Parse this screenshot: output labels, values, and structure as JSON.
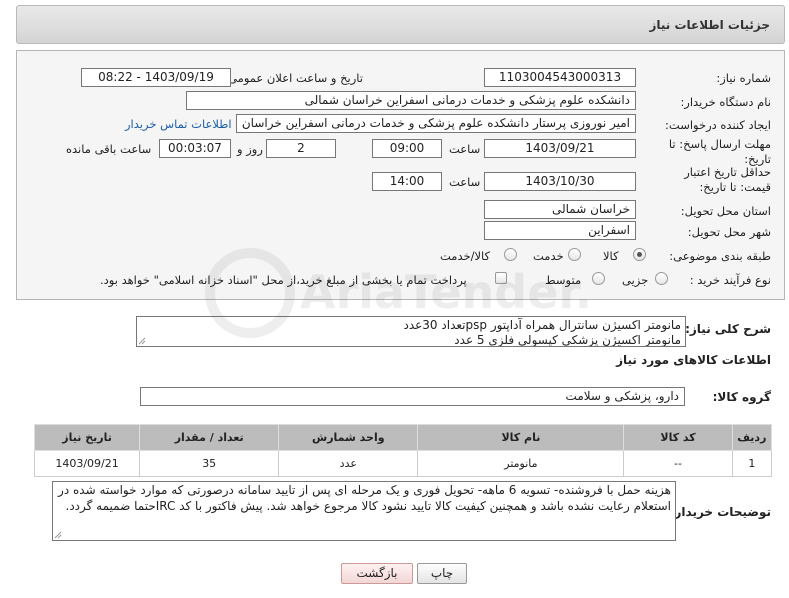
{
  "header": {
    "title": "جزئیات اطلاعات نیاز"
  },
  "fields": {
    "need_number": {
      "label": "شماره نیاز:",
      "value": "1103004543000313"
    },
    "announce_datetime": {
      "label": "تاریخ و ساعت اعلان عمومی:",
      "value": "1403/09/19 - 08:22"
    },
    "buyer_org": {
      "label": "نام دستگاه خریدار:",
      "value": "دانشکده علوم پزشکی و خدمات درمانی اسفراین خراسان شمالی"
    },
    "requester": {
      "label": "ایجاد کننده درخواست:",
      "value": "امیر  نوروزی  پرستار  دانشکده علوم پزشکی و خدمات درمانی اسفراین خراسان"
    },
    "buyer_contact_link": "اطلاعات تماس خریدار",
    "response_deadline": {
      "label": "مهلت ارسال پاسخ: تا تاریخ:",
      "date": "1403/09/21",
      "time_label": "ساعت",
      "time": "09:00",
      "days": "2",
      "days_label": "روز و",
      "remaining": "00:03:07",
      "remaining_label": "ساعت باقی مانده"
    },
    "price_validity": {
      "label": "حداقل تاریخ اعتبار قیمت: تا تاریخ:",
      "date": "1403/10/30",
      "time_label": "ساعت",
      "time": "14:00"
    },
    "delivery_province": {
      "label": "استان محل تحویل:",
      "value": "خراسان شمالی"
    },
    "delivery_city": {
      "label": "شهر محل تحویل:",
      "value": "اسفراین"
    },
    "category": {
      "label": "طبقه بندی موضوعی:",
      "options": [
        "کالا",
        "خدمت",
        "کالا/خدمت"
      ],
      "selected": "کالا"
    },
    "purchase_process": {
      "label": "نوع فرآیند خرید :",
      "options": [
        "جزیی",
        "متوسط"
      ],
      "selected": "جزیی",
      "payment_note": "پرداخت تمام یا بخشی از مبلغ خرید،از محل \"اسناد خزانه اسلامی\" خواهد بود."
    }
  },
  "general_description": {
    "label": "شرح کلی نیاز:",
    "line1": "مانومتر اکسیژن سانترال همراه آداپتور pspتعداد 30عدد",
    "line2": "مانومتر اکسیژن پزشکی کپسولی فلزی 5 عدد"
  },
  "goods_info": {
    "title": "اطلاعات کالاهای مورد نیاز",
    "group_label": "گروه کالا:",
    "group_value": "دارو، پزشکی و سلامت"
  },
  "table": {
    "headers": [
      "ردیف",
      "کد کالا",
      "نام کالا",
      "واحد شمارش",
      "تعداد / مقدار",
      "تاریخ نیاز"
    ],
    "rows": [
      [
        "1",
        "--",
        "مانومتر",
        "عدد",
        "35",
        "1403/09/21"
      ]
    ]
  },
  "buyer_notes": {
    "label": "توضیحات خریدار:",
    "text": "هزینه حمل با فروشنده- تسویه 6 ماهه- تحویل فوری و یک مرحله ای پس از تایید سامانه درصورتی که موارد خواسته شده در استعلام رعایت نشده باشد و همچنین کیفیت کالا تایید نشود کالا مرجوع خواهد شد. پیش فاکتور با کد IRCحتما ضمیمه گردد."
  },
  "buttons": {
    "print": "چاپ",
    "back": "بازگشت"
  },
  "watermark_text": "AriaTender.neT"
}
